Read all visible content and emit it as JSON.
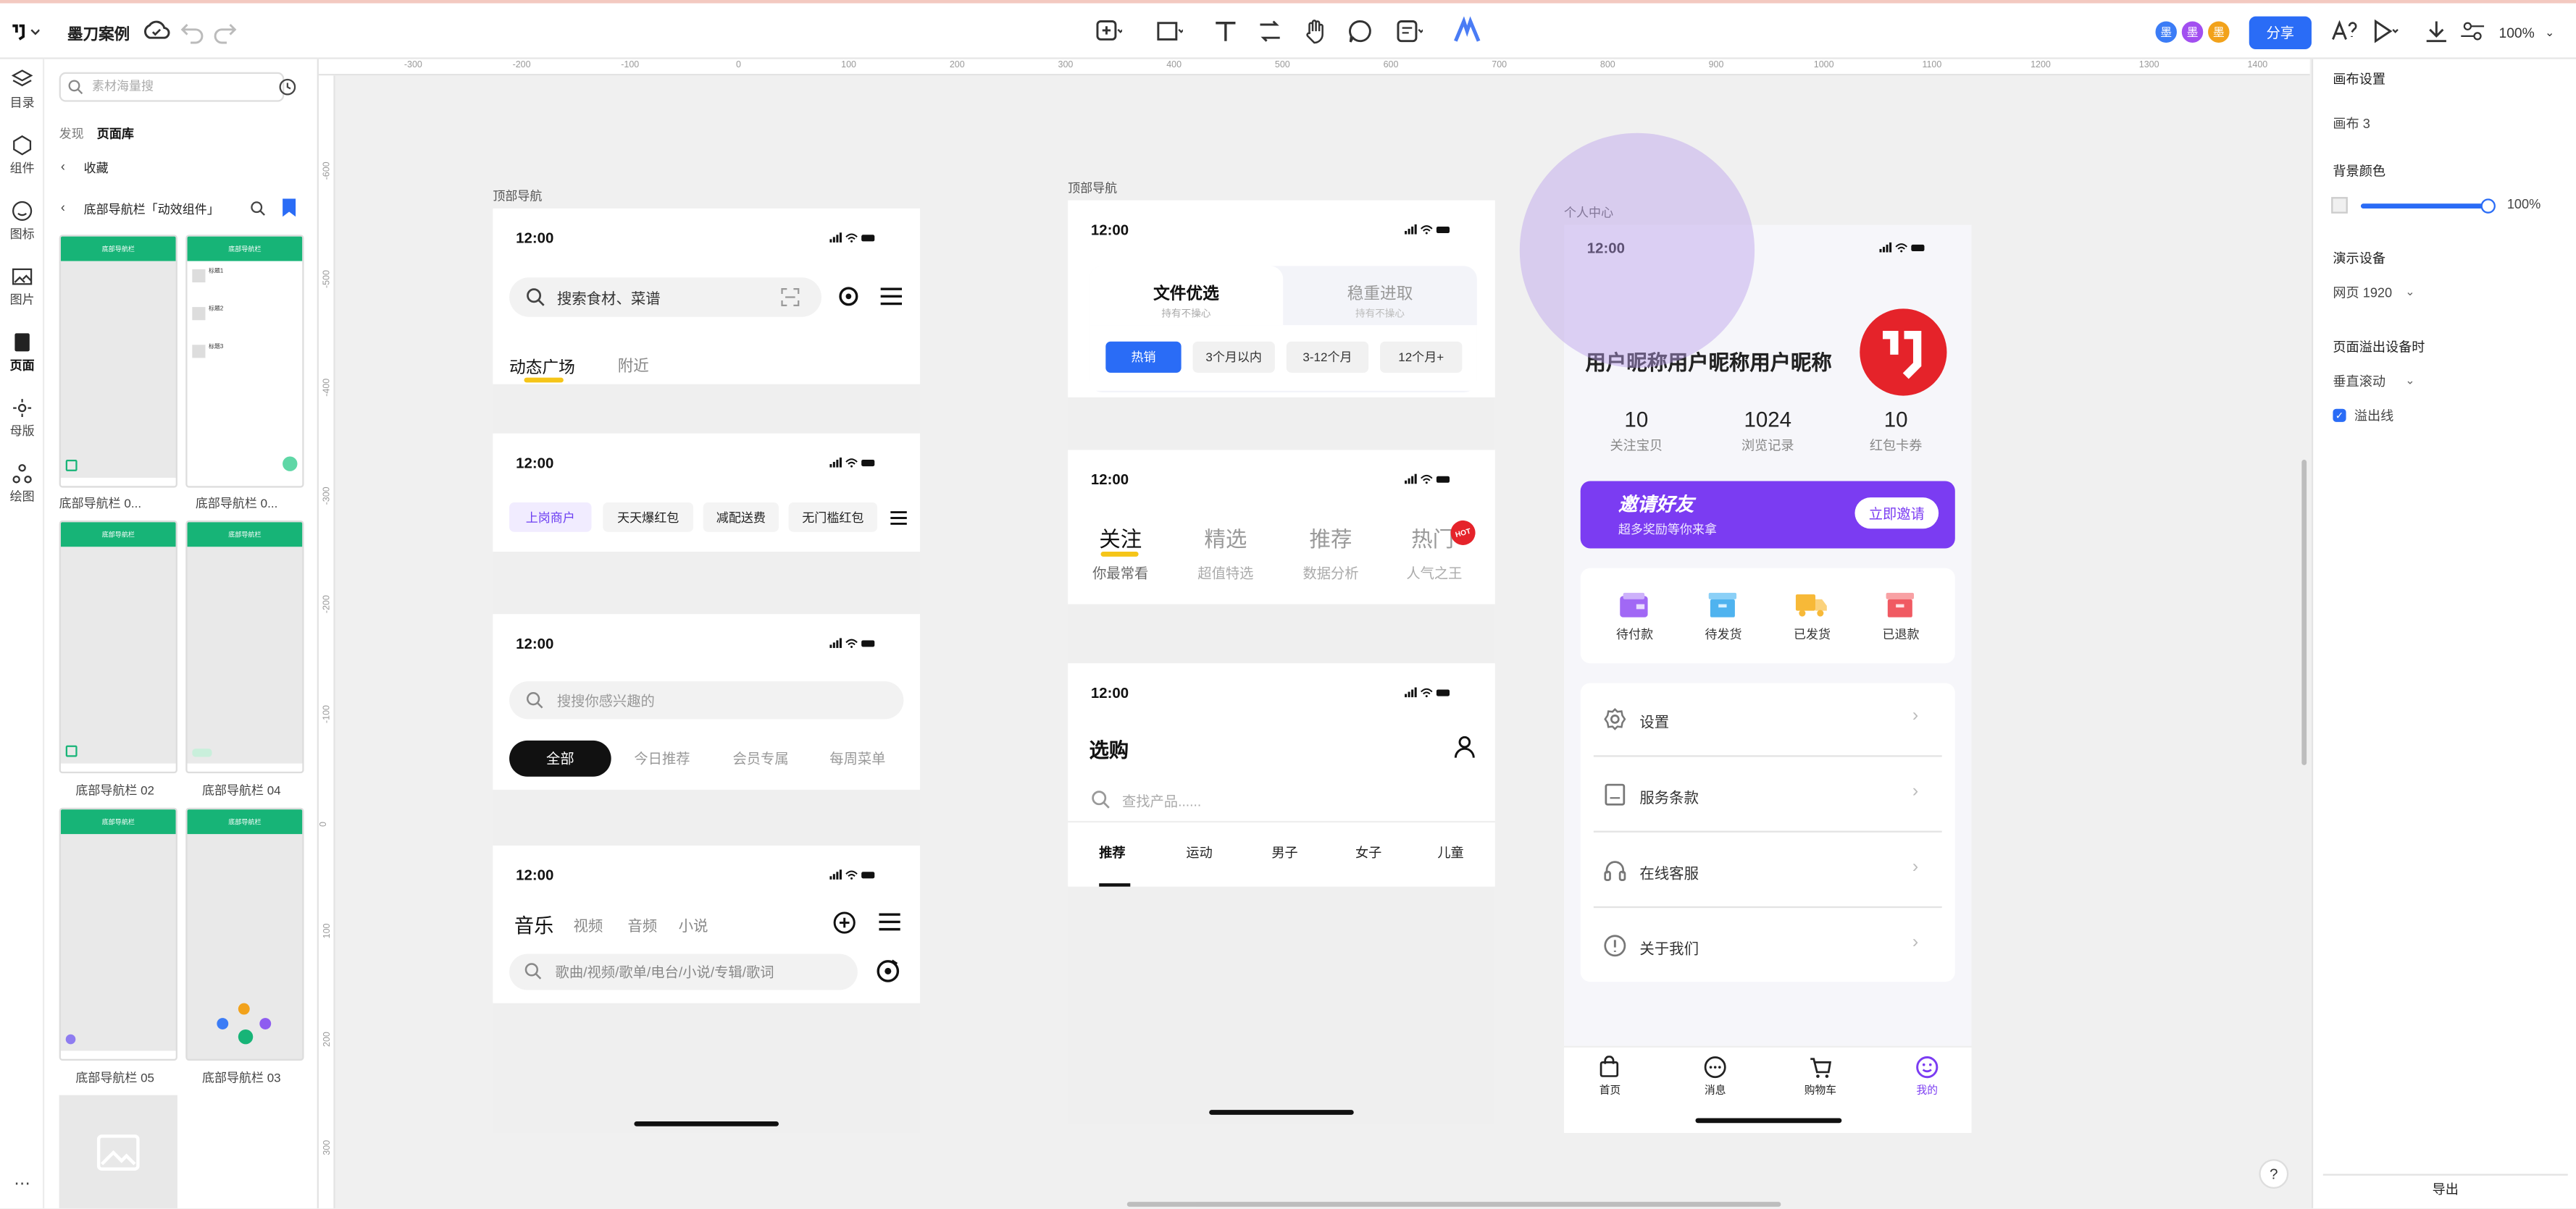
{
  "topbar": {
    "project_name": "墨刀案例",
    "avatars": [
      "墨",
      "墨",
      "墨"
    ],
    "share_label": "分享",
    "zoom": "100%"
  },
  "rail": {
    "items": [
      "目录",
      "组件",
      "图标",
      "图片",
      "页面",
      "母版",
      "绘图"
    ]
  },
  "library": {
    "search_placeholder": "素材海量搜",
    "tab_discover": "发现",
    "tab_pages": "页面库",
    "back_label": "收藏",
    "category": "底部导航栏「动效组件」",
    "thumbs": [
      {
        "label": "底部导航栏 0...",
        "title": "底部导航栏"
      },
      {
        "label": "底部导航栏 0...",
        "title": "底部导航栏"
      },
      {
        "label": "底部导航栏 02",
        "title": "底部导航栏"
      },
      {
        "label": "底部导航栏 04",
        "title": "底部导航栏"
      },
      {
        "label": "底部导航栏 05",
        "title": "底部导航栏"
      },
      {
        "label": "底部导航栏 03",
        "title": "底部导航栏"
      }
    ],
    "list_items": [
      "标题1",
      "标题2",
      "标题3"
    ]
  },
  "rulers": {
    "h": [
      "-300",
      "-200",
      "-100",
      "0",
      "100",
      "200",
      "300",
      "400",
      "500",
      "600",
      "700",
      "800",
      "900",
      "1000",
      "1100",
      "1200",
      "1300",
      "1400"
    ],
    "v": [
      "-600",
      "-500",
      "-400",
      "-300",
      "-200",
      "-100",
      "0",
      "100",
      "200",
      "300"
    ]
  },
  "frames": {
    "f1": {
      "label": "顶部导航",
      "time": "12:00",
      "s1_search": "搜索食材、菜谱",
      "s1_tabs": [
        "动态广场",
        "附近"
      ],
      "s2_tabs": [
        "上岗商户",
        "天天爆红包",
        "减配送费",
        "无门槛红包"
      ],
      "s3_search": "搜搜你感兴趣的",
      "s3_tabs": [
        "全部",
        "今日推荐",
        "会员专属",
        "每周菜单"
      ],
      "s4_tabs": [
        "音乐",
        "视频",
        "音频",
        "小说"
      ],
      "s4_search": "歌曲/视频/歌单/电台/小说/专辑/歌词"
    },
    "f2": {
      "label": "顶部导航",
      "time": "12:00",
      "seg1_title": "文件优选",
      "seg1_sub": "持有不操心",
      "seg2_title": "稳重进取",
      "seg2_sub": "持有不操心",
      "chips": [
        "热销",
        "3个月以内",
        "3-12个月",
        "12个月+"
      ],
      "s2_tabs": [
        {
          "title": "关注",
          "sub": "你最常看"
        },
        {
          "title": "精选",
          "sub": "超值特选"
        },
        {
          "title": "推荐",
          "sub": "数据分析"
        },
        {
          "title": "热门",
          "sub": "人气之王"
        }
      ],
      "hot_badge": "HOT",
      "s3_title": "选购",
      "s3_search": "查找产品......",
      "s3_tabs": [
        "推荐",
        "运动",
        "男子",
        "女子",
        "儿童"
      ]
    },
    "f3": {
      "label": "个人中心",
      "time": "12:00",
      "nickname": "用户昵称用户昵称用户昵称",
      "stats": [
        {
          "value": "10",
          "label": "关注宝贝"
        },
        {
          "value": "1024",
          "label": "浏览记录"
        },
        {
          "value": "10",
          "label": "红包卡券"
        }
      ],
      "invite_title": "邀请好友",
      "invite_sub": "超多奖励等你来拿",
      "invite_button": "立即邀请",
      "orders": [
        "待付款",
        "待发货",
        "已发货",
        "已退款"
      ],
      "menu": [
        "设置",
        "服务条款",
        "在线客服",
        "关于我们"
      ],
      "tabbar": [
        "首页",
        "消息",
        "购物车",
        "我的"
      ]
    }
  },
  "props": {
    "title": "画布设置",
    "canvas_name": "画布 3",
    "bg_label": "背景颜色",
    "bg_opacity": "100%",
    "bg_level": 1.0,
    "device_label": "演示设备",
    "device_value": "网页 1920",
    "overflow_label": "页面溢出设备时",
    "overflow_value": "垂直滚动",
    "overflow_line": "溢出线",
    "export_label": "导出"
  },
  "help": "?",
  "colors": {
    "accent": "#2a6cf6",
    "purple": "#7b3cf2",
    "green": "#17b477",
    "red": "#e5232a",
    "yellow_underline": "#f5c518"
  }
}
